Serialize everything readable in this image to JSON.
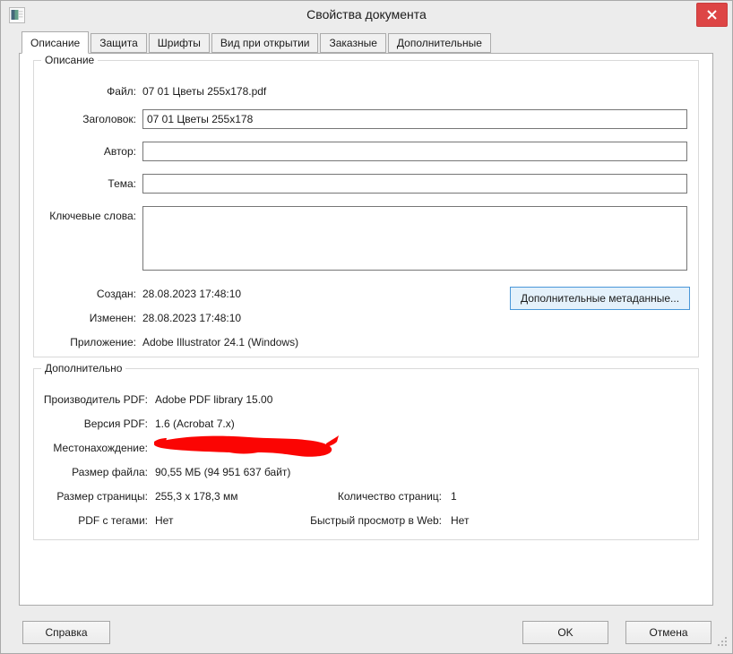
{
  "window": {
    "title": "Свойства документа"
  },
  "tabs": [
    {
      "label": "Описание",
      "active": true
    },
    {
      "label": "Защита",
      "active": false
    },
    {
      "label": "Шрифты",
      "active": false
    },
    {
      "label": "Вид при открытии",
      "active": false
    },
    {
      "label": "Заказные",
      "active": false
    },
    {
      "label": "Дополнительные",
      "active": false
    }
  ],
  "description": {
    "group_title": "Описание",
    "file_label": "Файл:",
    "file_value": "07 01 Цветы 255x178.pdf",
    "title_label": "Заголовок:",
    "title_value": "07 01 Цветы 255x178",
    "author_label": "Автор:",
    "author_value": "",
    "subject_label": "Тема:",
    "subject_value": "",
    "keywords_label": "Ключевые слова:",
    "keywords_value": "",
    "created_label": "Создан:",
    "created_value": "28.08.2023 17:48:10",
    "modified_label": "Изменен:",
    "modified_value": "28.08.2023 17:48:10",
    "application_label": "Приложение:",
    "application_value": "Adobe Illustrator 24.1 (Windows)",
    "metadata_button": "Дополнительные метаданные..."
  },
  "advanced": {
    "group_title": "Дополнительно",
    "producer_label": "Производитель PDF:",
    "producer_value": "Adobe PDF library 15.00",
    "version_label": "Версия PDF:",
    "version_value": "1.6 (Acrobat 7.x)",
    "location_label": "Местонахождение:",
    "filesize_label": "Размер файла:",
    "filesize_value": "90,55 МБ (94 951 637 байт)",
    "pagesize_label": "Размер страницы:",
    "pagesize_value": "255,3 x 178,3 мм",
    "pagecount_label": "Количество страниц:",
    "pagecount_value": "1",
    "tagged_label": "PDF с тегами:",
    "tagged_value": "Нет",
    "webview_label": "Быстрый просмотр в Web:",
    "webview_value": "Нет"
  },
  "footer": {
    "help": "Справка",
    "ok": "OK",
    "cancel": "Отмена"
  },
  "colors": {
    "close_button": "#dd4545",
    "metadata_button_bg": "#e4f1fb",
    "metadata_button_border": "#4a97d8",
    "redaction": "#fb0503",
    "dialog_bg": "#ececec",
    "page_bg": "#ffffff"
  }
}
